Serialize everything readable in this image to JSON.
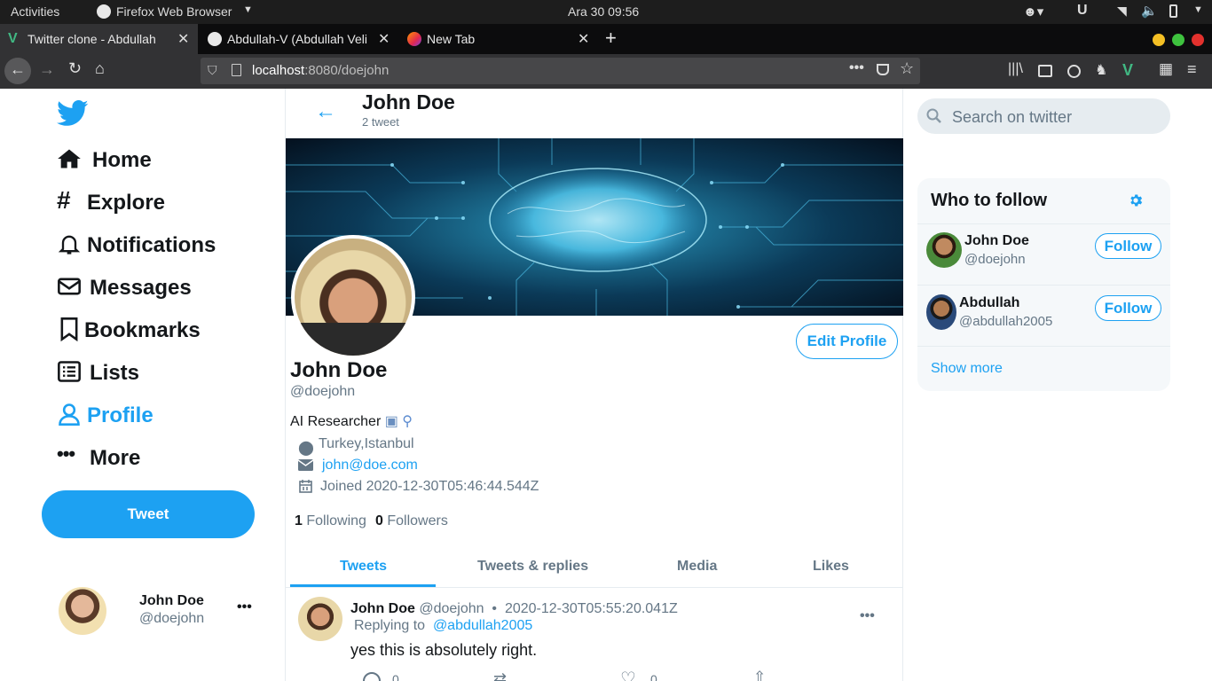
{
  "gnome": {
    "activities": "Activities",
    "app_name": "Firefox Web Browser",
    "clock": "Ara 30  09:56"
  },
  "browser": {
    "tabs": [
      {
        "label": "Twitter clone - Abdullah",
        "active": true
      },
      {
        "label": "Abdullah-V (Abdullah Veli",
        "active": false
      },
      {
        "label": "New Tab",
        "active": false
      }
    ],
    "url_host": "localhost",
    "url_path": ":8080/doejohn"
  },
  "sidebar": {
    "items": [
      {
        "label": "Home",
        "icon": "home-icon"
      },
      {
        "label": "Explore",
        "icon": "hashtag-icon"
      },
      {
        "label": "Notifications",
        "icon": "bell-icon"
      },
      {
        "label": "Messages",
        "icon": "envelope-icon"
      },
      {
        "label": "Bookmarks",
        "icon": "bookmark-icon"
      },
      {
        "label": "Lists",
        "icon": "list-icon"
      },
      {
        "label": "Profile",
        "icon": "user-icon"
      },
      {
        "label": "More",
        "icon": "more-icon"
      }
    ],
    "tweet_button": "Tweet",
    "account_name": "John Doe",
    "account_handle": "@doejohn"
  },
  "profile": {
    "header_name": "John Doe",
    "tweet_count": "2 tweet",
    "name": "John Doe",
    "handle": "@doejohn",
    "bio": "AI Researcher",
    "location": "Turkey,Istanbul",
    "email": "john@doe.com",
    "joined": "Joined 2020-12-30T05:46:44.544Z",
    "following_count": "1",
    "following_label": "Following",
    "followers_count": "0",
    "followers_label": "Followers",
    "edit_button": "Edit Profile"
  },
  "tabs": [
    "Tweets",
    "Tweets & replies",
    "Media",
    "Likes"
  ],
  "tweet": {
    "author": "John Doe",
    "handle": "@doejohn",
    "timestamp": "2020-12-30T05:55:20.041Z",
    "replying_label": "Replying to",
    "replying_to": "@abdullah2005",
    "text": "yes this is absolutely right.",
    "reply_count": "0",
    "like_count": "0"
  },
  "right": {
    "search_placeholder": "Search on twitter",
    "who_title": "Who to follow",
    "suggestions": [
      {
        "name": "John Doe",
        "handle": "@doejohn",
        "button": "Follow"
      },
      {
        "name": "Abdullah",
        "handle": "@abdullah2005",
        "button": "Follow"
      }
    ],
    "show_more": "Show more"
  },
  "colors": {
    "accent": "#1da1f2",
    "text": "#14171a",
    "muted": "#657786"
  }
}
